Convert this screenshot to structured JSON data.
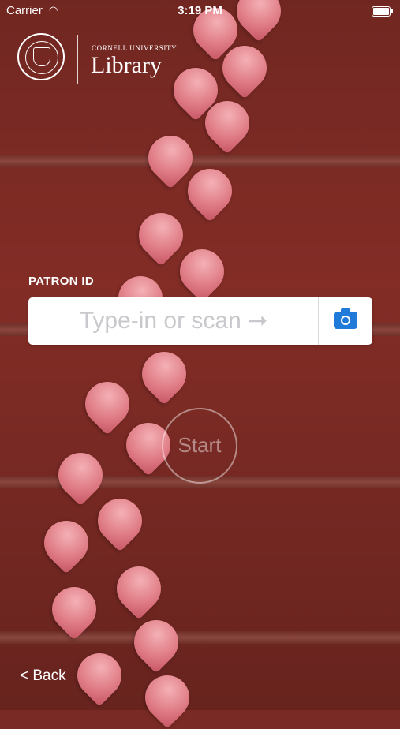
{
  "status_bar": {
    "carrier": "Carrier",
    "wifi_icon": "wifi-icon",
    "time": "3:19 PM",
    "battery_icon": "battery-icon"
  },
  "logo": {
    "seal_icon": "cornell-seal-icon",
    "institution": "CORNELL UNIVERSITY",
    "title": "Library"
  },
  "patron": {
    "label": "PATRON ID",
    "input_placeholder": "Type-in or scan ➞",
    "input_value": "",
    "scan_icon": "camera-icon",
    "scan_icon_color": "#1f7ad9"
  },
  "start_button": {
    "label": "Start"
  },
  "navigation": {
    "back_label": "< Back"
  }
}
